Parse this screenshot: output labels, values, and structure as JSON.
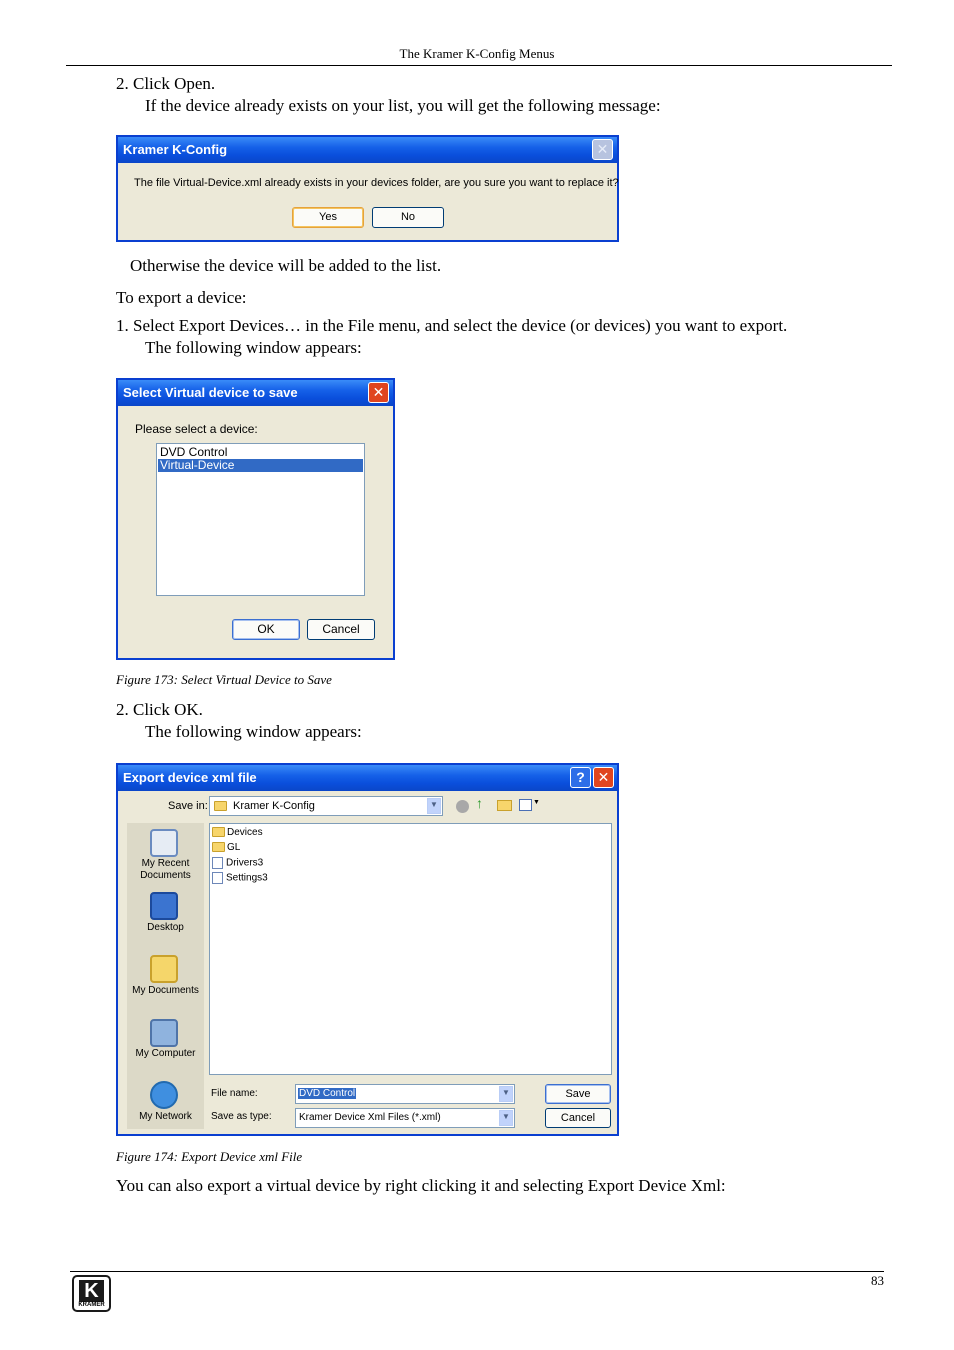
{
  "header": {
    "title": "The Kramer K-Config Menus"
  },
  "body": {
    "step2_open": "2.  Click Open.",
    "step2_open_sub": "If the device already exists on your list, you will get the following message:",
    "otherwise": "Otherwise the device will be added to the list.",
    "export_intro": "To export a device:",
    "step1_export": "1.  Select Export Devices… in the File menu, and select the device (or devices) you want to export.",
    "step1_export_sub": "The following window appears:",
    "step2_ok": "2.  Click OK.",
    "step2_ok_sub": "The following window appears:",
    "closing": "You can also export a virtual device by right clicking it and selecting Export Device Xml:"
  },
  "dialog_replace": {
    "title": "Kramer K-Config",
    "message": "The file Virtual-Device.xml already exists in your devices folder, are you sure you want to replace it?",
    "yes": "Yes",
    "no": "No"
  },
  "dialog_select": {
    "title": "Select Virtual device to save",
    "prompt": "Please select a device:",
    "items": [
      "DVD Control",
      "Virtual-Device"
    ],
    "ok": "OK",
    "cancel": "Cancel"
  },
  "figure173": "Figure 173: Select Virtual Device to Save",
  "dialog_export": {
    "title": "Export device xml file",
    "help": "?",
    "save_in_label": "Save in:",
    "save_in_value": "Kramer K-Config",
    "places": [
      "My Recent Documents",
      "Desktop",
      "My Documents",
      "My Computer",
      "My Network"
    ],
    "files": [
      "Devices",
      "GL",
      "Drivers3",
      "Settings3"
    ],
    "filename_label": "File name:",
    "filename_value": "DVD Control",
    "savetype_label": "Save as type:",
    "savetype_value": "Kramer Device Xml Files (*.xml)",
    "save": "Save",
    "cancel": "Cancel"
  },
  "figure174": "Figure 174: Export Device xml File",
  "footer": {
    "page_number": "83",
    "logo_text": "KRAMER"
  },
  "colors": {
    "xp_title": "#0a4fdc",
    "xp_face": "#ece9d8",
    "close_red": "#e0451f",
    "selection": "#316ac5"
  }
}
